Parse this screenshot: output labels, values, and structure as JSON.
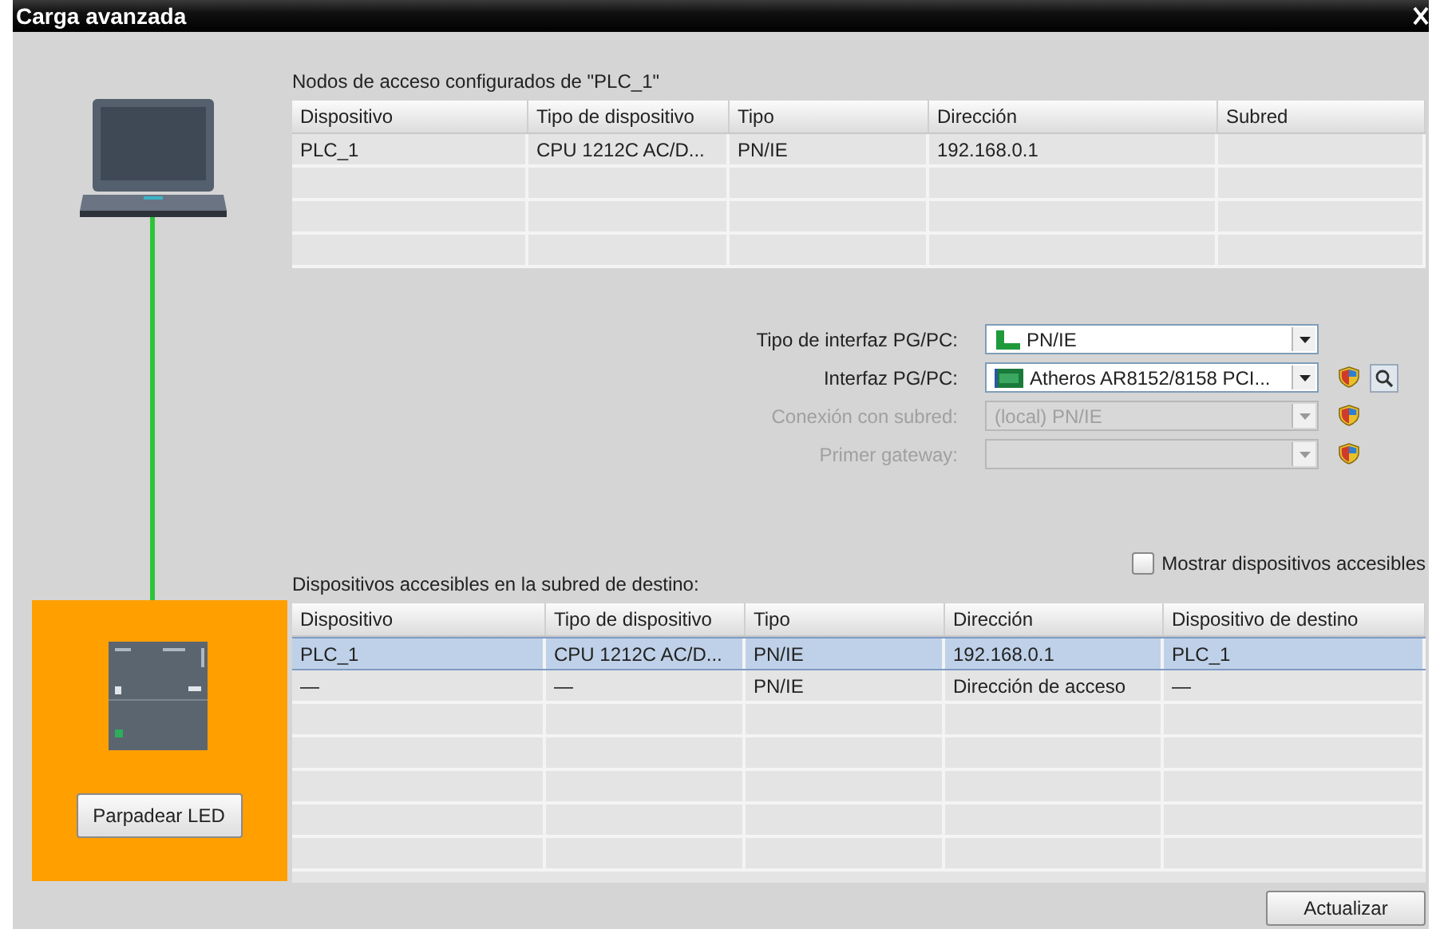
{
  "window": {
    "title": "Carga avanzada"
  },
  "device_panel": {
    "active": true,
    "button": "Parpadear LED"
  },
  "configured_nodes": {
    "caption": "Nodos de acceso configurados de \"PLC_1\"",
    "columns": [
      "Dispositivo",
      "Tipo de dispositivo",
      "Tipo",
      "Dirección",
      "Subred"
    ],
    "rows": [
      {
        "cells": [
          "PLC_1",
          "CPU 1212C AC/D...",
          "PN/IE",
          "192.168.0.1"
        ]
      }
    ]
  },
  "interface_fields": [
    {
      "kind": "protocol",
      "label": "Tipo de interfaz PG/PC:",
      "value": "PN/IE",
      "disabled": false,
      "shield": false,
      "search_button": false
    },
    {
      "kind": "adapter",
      "label": "Interfaz PG/PC:",
      "value": "Atheros AR8152/8158 PCI...",
      "disabled": false,
      "shield": true,
      "search_button": true
    },
    {
      "kind": "plain",
      "label": "Conexión con subred:",
      "value": "(local) PN/IE",
      "disabled": true,
      "shield": true,
      "search_button": false
    },
    {
      "kind": "plain",
      "label": "Primer gateway:",
      "disabled": true,
      "shield": true,
      "search_button": false
    }
  ],
  "accessible_devices": {
    "caption": "Dispositivos accesibles en la subred de destino:",
    "checkbox": {
      "label": "Mostrar dispositivos accesibles",
      "checked": false
    },
    "columns": [
      "Dispositivo",
      "Tipo de dispositivo",
      "Tipo",
      "Dirección",
      "Dispositivo de destino"
    ],
    "rows": [
      {
        "cells": [
          "PLC_1",
          "CPU 1212C AC/D...",
          "PN/IE",
          "192.168.0.1",
          "PLC_1"
        ],
        "selected": true
      },
      {
        "cells": [
          "—",
          "—",
          "PN/IE",
          "Dirección de acceso",
          "—"
        ],
        "selected": false
      }
    ]
  },
  "refresh_button": "Actualizar"
}
